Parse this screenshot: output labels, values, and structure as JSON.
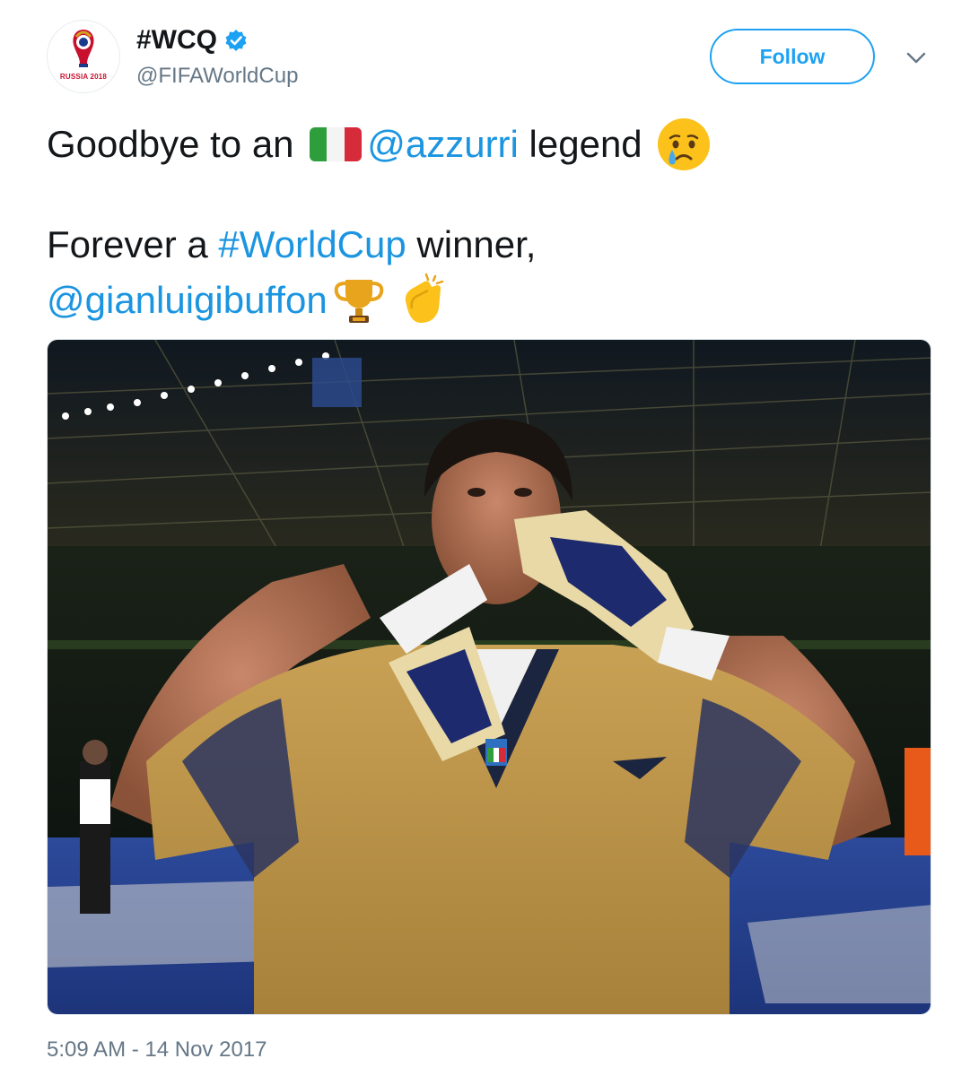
{
  "account": {
    "display_name": "#WCQ",
    "handle": "@FIFAWorldCup",
    "verified": true,
    "avatar_caption": "RUSSIA 2018"
  },
  "actions": {
    "follow_label": "Follow",
    "more_icon": "chevron-down-icon"
  },
  "tweet": {
    "line1_prefix": "Goodbye to an ",
    "line1_flag_emoji": "italy-flag-emoji",
    "line1_mention": "@azzurri",
    "line1_suffix": " legend ",
    "line1_emoji": "crying-face-emoji",
    "line2_prefix": "Forever a ",
    "line2_hashtag": "#WorldCup",
    "line2_suffix": " winner,",
    "line3_mention": "@gianluigibuffon",
    "line3_emojis": [
      "trophy-emoji",
      "clapping-hands-emoji"
    ]
  },
  "media": {
    "image_subject": "goalkeeper-kissing-gloves-photo"
  },
  "timestamp": "5:09 AM - 14 Nov 2017",
  "colors": {
    "link": "#1b95e0",
    "brand": "#1da1f2",
    "secondary_text": "#657786"
  }
}
